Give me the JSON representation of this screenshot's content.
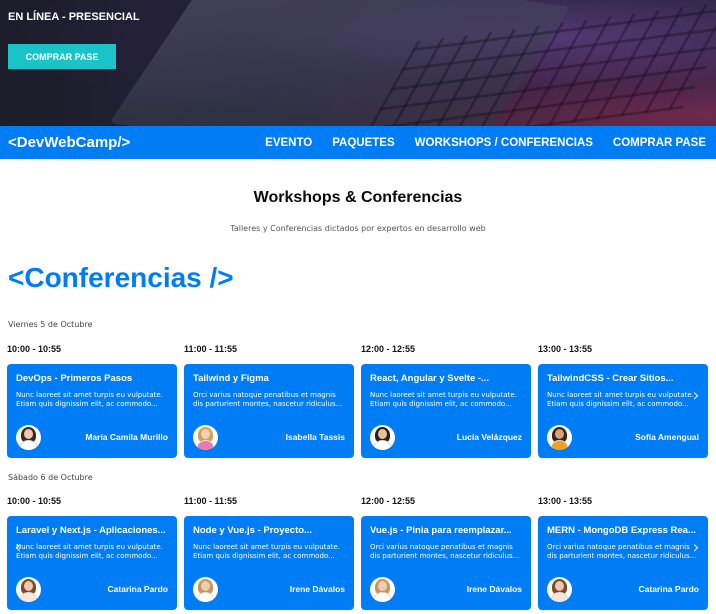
{
  "hero": {
    "tagline": "EN LÍNEA - PRESENCIAL",
    "buy_label": "COMPRAR PASE"
  },
  "navbar": {
    "logo": "<DevWebCamp/>",
    "links": [
      "EVENTO",
      "PAQUETES",
      "WORKSHOPS / CONFERENCIAS",
      "COMPRAR PASE"
    ]
  },
  "section": {
    "title": "Workshops & Conferencias",
    "subtitle": "Talleres y Conferencias dictados por expertos en desarrollo web",
    "heading": "<Conferencias />"
  },
  "days": [
    {
      "label": "Viernes 5 de Octubre",
      "events": [
        {
          "time": "10:00 - 10:55",
          "title": "DevOps - Primeros Pasos",
          "description": "Nunc laoreet sit amet turpis eu vulputate. Etiam quis dignissim elit, ac commodo...",
          "speaker": "María Camila Murillo",
          "avatar": {
            "hair": "#3a2a22",
            "skin": "#f0c8a8",
            "shirt": "#ffffff"
          }
        },
        {
          "time": "11:00 - 11:55",
          "title": "Tailwind y Figma",
          "description": "Orci varius natoque penatibus et magnis dis parturient montes, nascetur ridiculus...",
          "speaker": "Isabella Tassis",
          "avatar": {
            "hair": "#d4a15a",
            "skin": "#f2cfb2",
            "shirt": "#e87ab0"
          }
        },
        {
          "time": "12:00 - 12:55",
          "title": "React, Angular y Svelte -...",
          "description": "Nunc laoreet sit amet turpis eu vulputate. Etiam quis dignissim elit, ac commodo...",
          "speaker": "Lucía Velázquez",
          "avatar": {
            "hair": "#2b221e",
            "skin": "#e8c0a0",
            "shirt": "#ffffff"
          }
        },
        {
          "time": "13:00 - 13:55",
          "title": "TailwindCSS - Crear Sitios...",
          "description": "Nunc laoreet sit amet turpis eu vulputate. Etiam quis dignissim elit, ac commodo...",
          "speaker": "Sofía Amengual",
          "avatar": {
            "hair": "#3b2416",
            "skin": "#d9a27a",
            "shirt": "#f0a020"
          }
        }
      ]
    },
    {
      "label": "Sábado 6 de Octubre",
      "events": [
        {
          "time": "10:00 - 10:55",
          "title": "Laravel y Next.js - Aplicaciones...",
          "description": "Nunc laoreet sit amet turpis eu vulputate. Etiam quis dignissim elit, ac commodo...",
          "speaker": "Catarina Pardo",
          "avatar": {
            "hair": "#7a4a2a",
            "skin": "#f0c9aa",
            "shirt": "#f5e6d8"
          }
        },
        {
          "time": "11:00 - 11:55",
          "title": "Node y Vue.js - Proyecto...",
          "description": "Nunc laoreet sit amet turpis eu vulputate. Etiam quis dignissim elit, ac commodo...",
          "speaker": "Irene Dávalos",
          "avatar": {
            "hair": "#c9955a",
            "skin": "#f1cdb0",
            "shirt": "#ffffff"
          }
        },
        {
          "time": "12:00 - 12:55",
          "title": "Vue.js - Pinia para reemplazar...",
          "description": "Orci varius natoque penatibus et magnis dis parturient montes, nascetur ridiculus...",
          "speaker": "Irene Dávalos",
          "avatar": {
            "hair": "#c9955a",
            "skin": "#f1cdb0",
            "shirt": "#ffffff"
          }
        },
        {
          "time": "13:00 - 13:55",
          "title": "MERN - MongoDB Express Rea...",
          "description": "Orci varius natoque penatibus et magnis dis parturient montes, nascetur ridiculus...",
          "speaker": "Catarina Pardo",
          "avatar": {
            "hair": "#7a4a2a",
            "skin": "#f0c9aa",
            "shirt": "#f5e6d8"
          }
        }
      ]
    }
  ],
  "icons": {
    "prev": "chevron-left-icon",
    "next": "chevron-right-icon"
  },
  "colors": {
    "brand_blue": "#007df4",
    "accent_teal": "#19c3c8"
  }
}
